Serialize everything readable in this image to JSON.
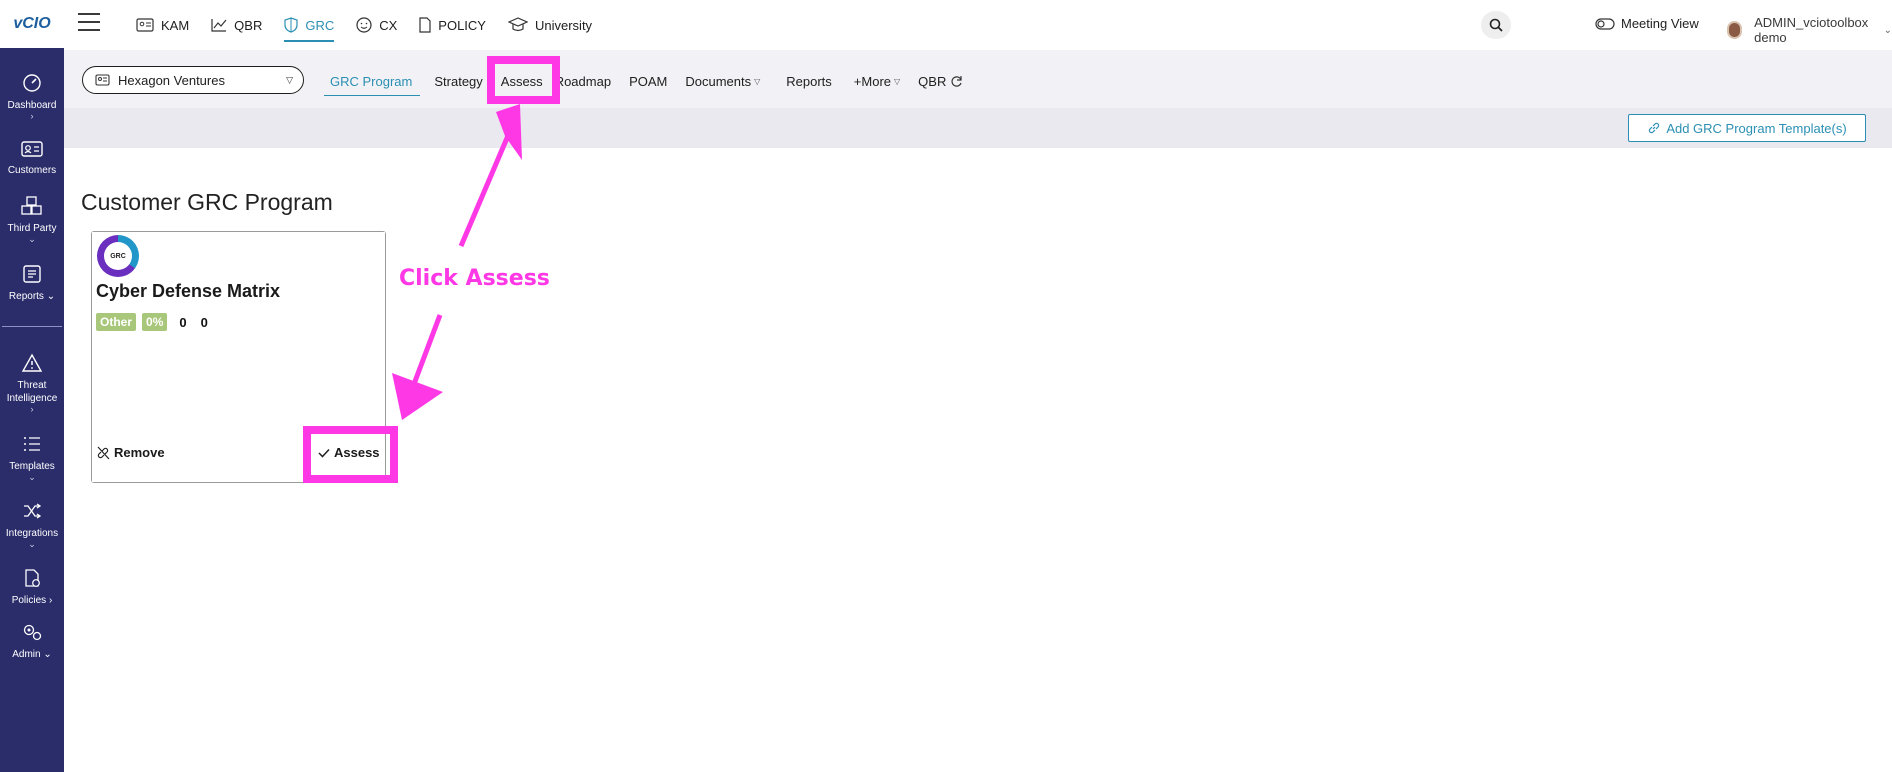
{
  "brand": {
    "logo_text": "vCIO"
  },
  "sidebar": {
    "items": [
      {
        "label": "Dashboard",
        "icon": "gauge-icon"
      },
      {
        "label": "Customers",
        "icon": "id-card-icon"
      },
      {
        "label": "Third Party",
        "icon": "cubes-icon"
      },
      {
        "label": "Reports",
        "icon": "report-icon"
      },
      {
        "label": "Threat Intelligence",
        "icon": "warning-icon"
      },
      {
        "label": "Templates",
        "icon": "list-icon"
      },
      {
        "label": "Integrations",
        "icon": "shuffle-icon"
      },
      {
        "label": "Policies",
        "icon": "policy-file-icon"
      },
      {
        "label": "Admin",
        "icon": "cogs-icon"
      }
    ]
  },
  "topnav": {
    "items": [
      {
        "label": "KAM",
        "icon": "id-card-icon"
      },
      {
        "label": "QBR",
        "icon": "chart-icon"
      },
      {
        "label": "GRC",
        "icon": "shield-icon",
        "active": true
      },
      {
        "label": "CX",
        "icon": "smile-icon"
      },
      {
        "label": "POLICY",
        "icon": "document-icon"
      },
      {
        "label": "University",
        "icon": "graduation-cap-icon"
      }
    ],
    "search_label": "Q..",
    "meeting_view": "Meeting View",
    "user_name": "ADMIN_vciotoolbox demo"
  },
  "subnav": {
    "customer": "Hexagon Ventures",
    "tabs": [
      {
        "label": "GRC Program",
        "active": true
      },
      {
        "label": "Strategy"
      },
      {
        "label": "Assess"
      },
      {
        "label": "Roadmap"
      },
      {
        "label": "POAM"
      },
      {
        "label": "Documents",
        "dropdown": true
      },
      {
        "label": "Reports"
      },
      {
        "label": "+More",
        "dropdown": true
      },
      {
        "label": "QBR"
      }
    ]
  },
  "actions": {
    "add_template": "Add GRC Program Template(s)"
  },
  "main": {
    "title": "Customer GRC Program",
    "card": {
      "logo_text": "GRC",
      "title": "Cyber Defense Matrix",
      "badge_type": "Other",
      "badge_progress": "0%",
      "count_a": "0",
      "count_b": "0",
      "remove_label": "Remove",
      "assess_label": "Assess"
    }
  },
  "annotation": {
    "callout": "Click Assess",
    "color": "#ff38e6"
  },
  "colors": {
    "sidebar": "#2b2d6b",
    "accent": "#2b8fb3",
    "badge": "#a8c77a"
  }
}
